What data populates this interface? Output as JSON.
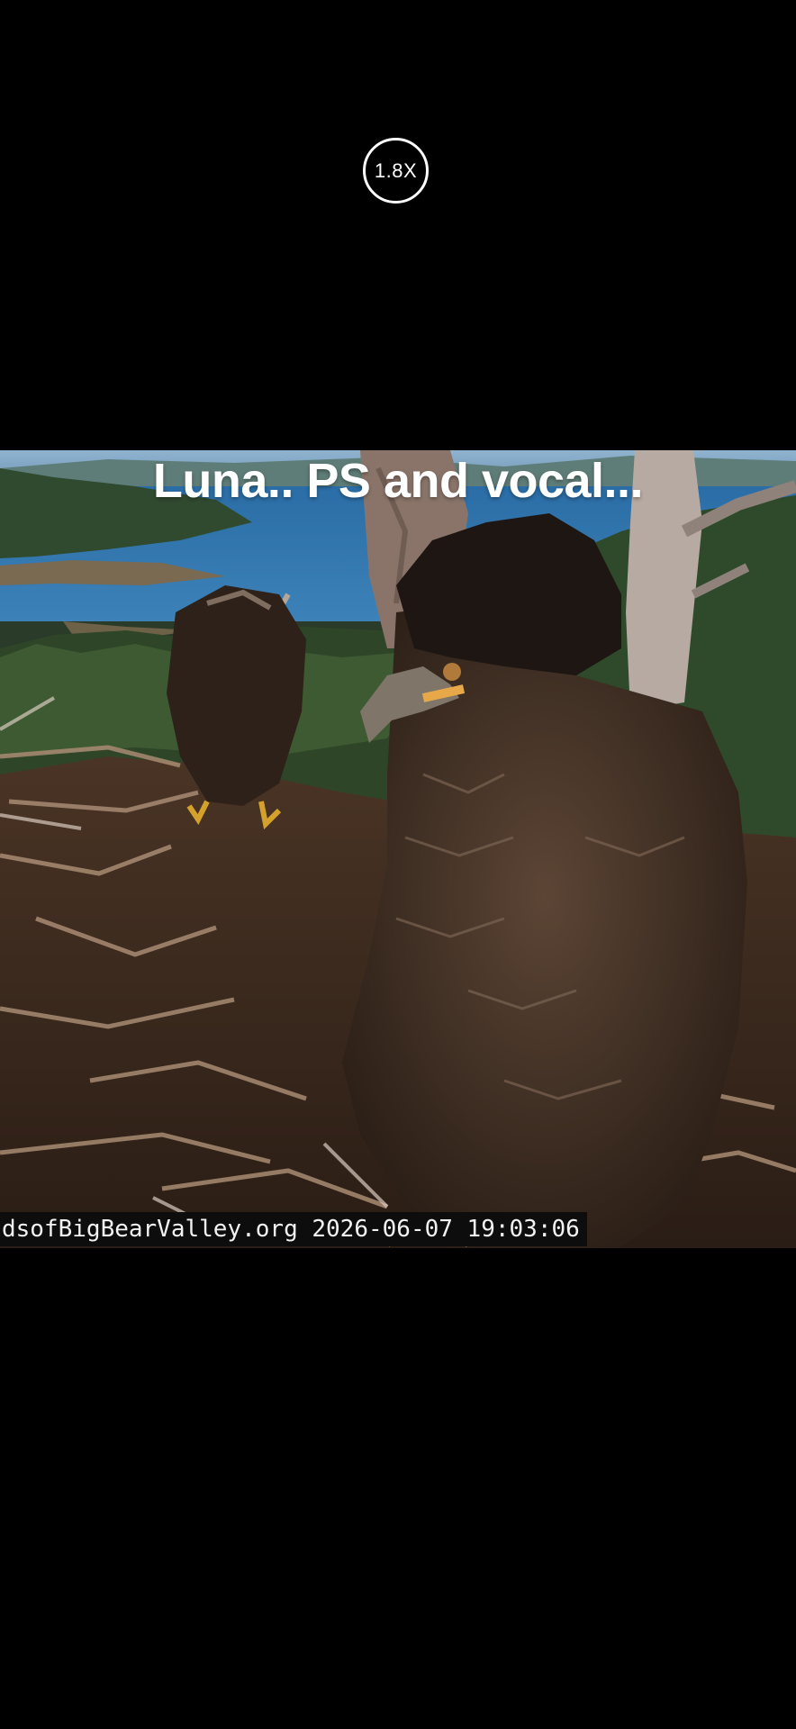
{
  "player": {
    "playback_speed": "1.8X",
    "caption": "Luna.. PS and vocal...",
    "overlay_timestamp": "dsofBigBearValley.org 2026-06-07 19:03:06"
  },
  "colors": {
    "background": "#000000",
    "text": "#ffffff"
  }
}
